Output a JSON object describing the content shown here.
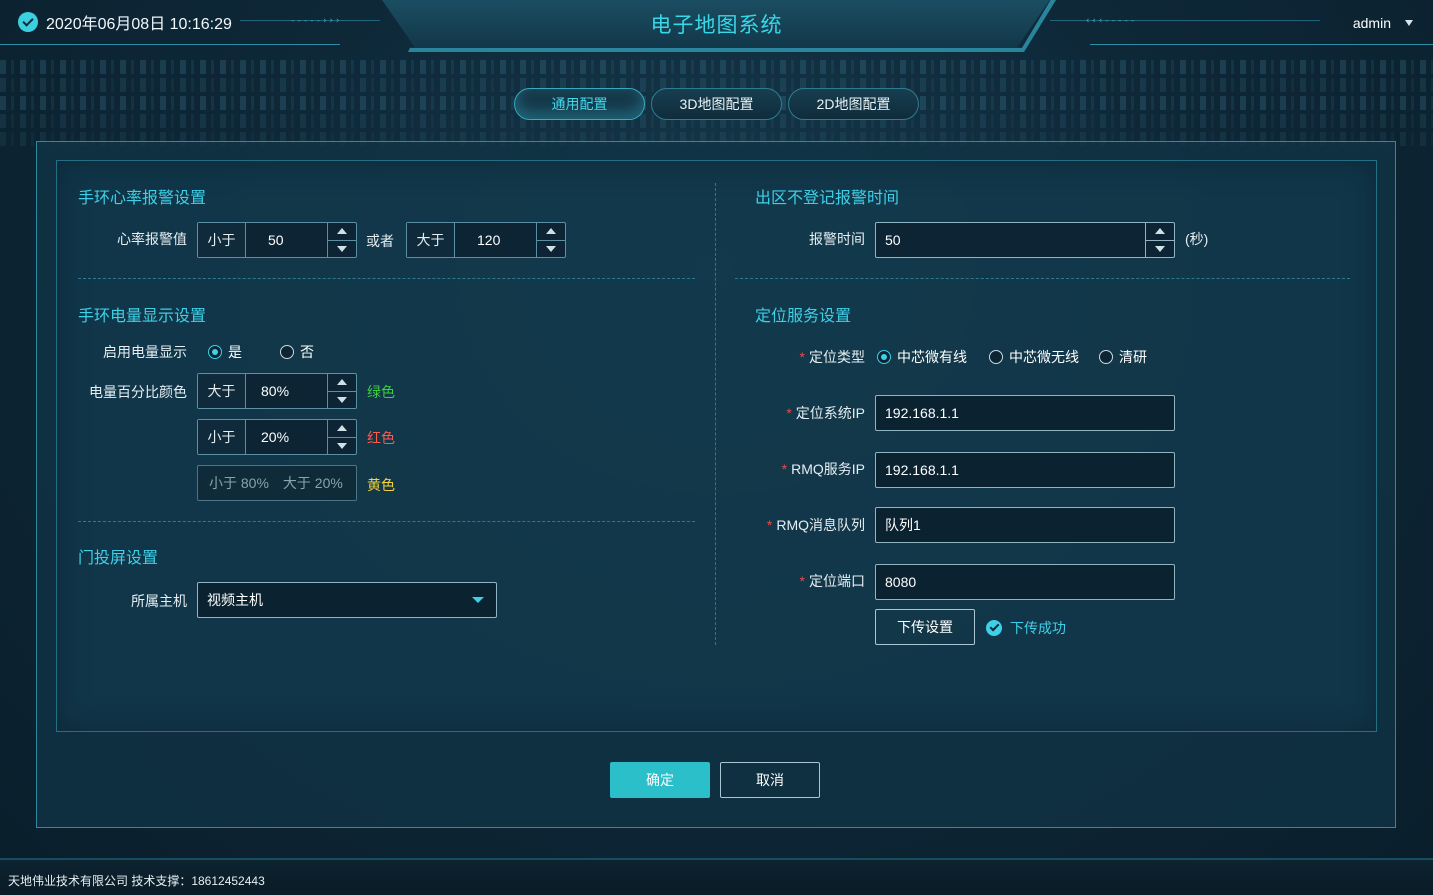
{
  "header": {
    "datetime": "2020年06月08日 10:16:29",
    "title": "电子地图系统",
    "user": "admin",
    "deco_left": "-----›››",
    "deco_right": "‹‹‹-----"
  },
  "tabs": [
    {
      "label": "通用配置",
      "active": true
    },
    {
      "label": "3D地图配置",
      "active": false
    },
    {
      "label": "2D地图配置",
      "active": false
    }
  ],
  "heart_rate": {
    "title": "手环心率报警设置",
    "label": "心率报警值",
    "low_prefix": "小于",
    "low_value": "50",
    "or_text": "或者",
    "high_prefix": "大于",
    "high_value": "120"
  },
  "battery": {
    "title": "手环电量显示设置",
    "enable_label": "启用电量显示",
    "option_yes": "是",
    "option_no": "否",
    "selected": "是",
    "color_label": "电量百分比颜色",
    "green_prefix": "大于",
    "green_value": "80%",
    "green_text": "绿色",
    "red_prefix": "小于",
    "red_value": "20%",
    "red_text": "红色",
    "yellow_part1": "小于 80%",
    "yellow_part2": "大于 20%",
    "yellow_text": "黄色"
  },
  "screen": {
    "title": "门投屏设置",
    "host_label": "所属主机",
    "host_value": "视频主机"
  },
  "exit_alarm": {
    "title": "出区不登记报警时间",
    "label": "报警时间",
    "value": "50",
    "unit": "(秒)"
  },
  "location": {
    "title": "定位服务设置",
    "type_label": "定位类型",
    "type_options": [
      "中芯微有线",
      "中芯微无线",
      "清研"
    ],
    "type_selected": "中芯微有线",
    "ip_label": "定位系统IP",
    "ip_value": "192.168.1.1",
    "rmq_ip_label": "RMQ服务IP",
    "rmq_ip_value": "192.168.1.1",
    "rmq_queue_label": "RMQ消息队列",
    "rmq_queue_value": "队列1",
    "port_label": "定位端口",
    "port_value": "8080",
    "push_button": "下传设置",
    "push_status": "下传成功",
    "required_mark": "*"
  },
  "actions": {
    "confirm": "确定",
    "cancel": "取消"
  },
  "footer": {
    "text": "天地伟业技术有限公司 技术支撑：18612452443"
  },
  "colors": {
    "accent": "#3ed0e6",
    "primary_button": "#2bbfc9",
    "green": "#3ad13a",
    "red": "#ff5a4e",
    "yellow": "#f2d33c"
  }
}
